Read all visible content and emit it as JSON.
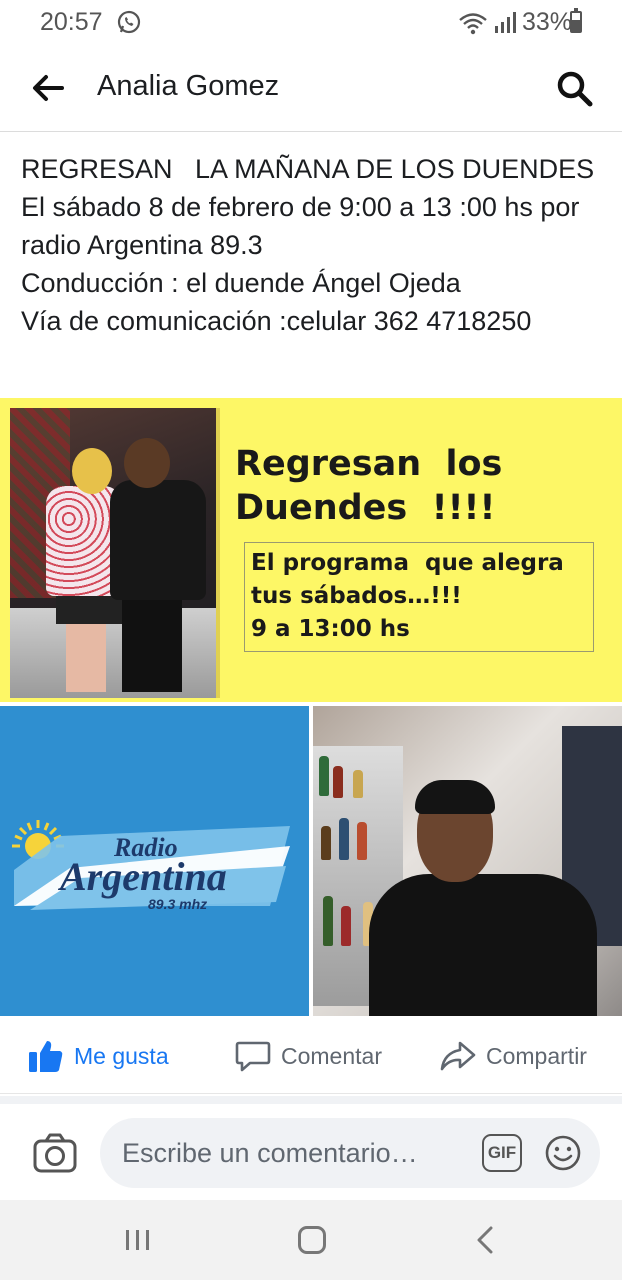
{
  "status_bar": {
    "time": "20:57",
    "battery": "33%",
    "icons": [
      "whatsapp-icon",
      "wifi-icon",
      "signal-icon",
      "battery-icon"
    ]
  },
  "header": {
    "title": "Analia Gomez",
    "back_icon": "arrow-left-icon",
    "search_icon": "search-icon"
  },
  "post": {
    "text": "REGRESAN   LA MAÑANA DE LOS DUENDES\nEl sábado 8 de febrero de 9:00 a 13 :00 hs por radio Argentina 89.3\nConducción : el duende Ángel Ojeda\nVía de comunicación :celular 362 4718250",
    "flyer": {
      "headline": "Regresan  los\nDuendes  !!!!",
      "subtext": "El programa  que alegra\ntus sábados…!!!\n9 a 13:00 hs"
    },
    "logo": {
      "line1": "Radio",
      "line2": "Argentina",
      "freq": "89.3 mhz"
    }
  },
  "actions": {
    "like": "Me gusta",
    "comment": "Comentar",
    "share": "Compartir"
  },
  "composer": {
    "placeholder": "Escribe un comentario…",
    "gif": "GIF"
  },
  "colors": {
    "facebook_blue": "#1877f2",
    "flyer_yellow": "#fdf766",
    "radio_blue": "#2f8fd0"
  }
}
